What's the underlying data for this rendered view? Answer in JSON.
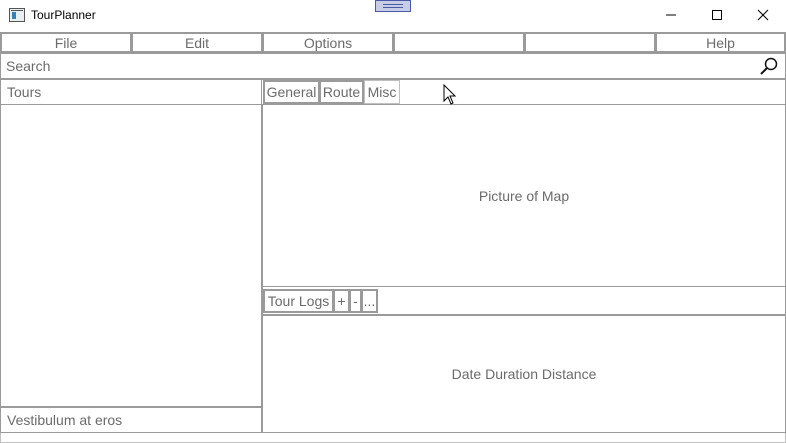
{
  "window": {
    "title": "TourPlanner"
  },
  "menu": {
    "file": "File",
    "edit": "Edit",
    "options": "Options",
    "empty1": "",
    "empty2": "",
    "help": "Help"
  },
  "search": {
    "placeholder": "Search"
  },
  "tours": {
    "header": "Tours",
    "selected_item": "Vestibulum at eros"
  },
  "tabs": {
    "general": "General",
    "route": "Route",
    "misc": "Misc"
  },
  "map": {
    "placeholder": "Picture of Map"
  },
  "logs": {
    "label": "Tour Logs",
    "add": "+",
    "remove": "-",
    "more": "...",
    "columns": "Date Duration Distance"
  },
  "icons": {
    "search": "search-icon",
    "app": "app-icon",
    "minimize": "minimize-icon",
    "maximize": "maximize-icon",
    "close": "close-icon"
  }
}
